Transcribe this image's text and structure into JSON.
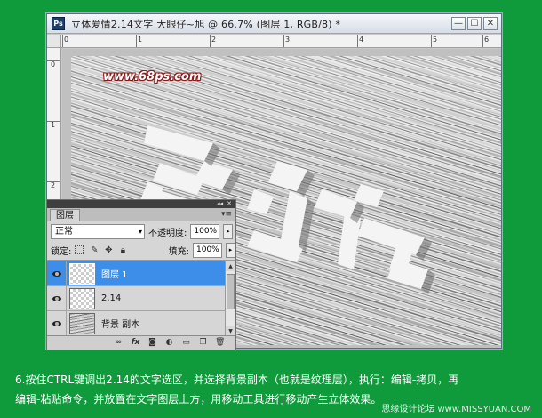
{
  "window": {
    "app_icon": "Ps",
    "title": "立体爱情2.14文字   大眼仔~旭 @ 66.7% (图层 1, RGB/8) *",
    "btn_min": "—",
    "btn_max": "☐",
    "btn_close": "✕"
  },
  "rulers": {
    "top": [
      "0",
      "1",
      "2",
      "3",
      "4",
      "5",
      "6"
    ],
    "left": [
      "0",
      "1",
      "2"
    ]
  },
  "canvas": {
    "watermark": "www.68ps.com"
  },
  "layers_panel": {
    "collapse": "◂◂",
    "close": "✕",
    "tab": "图层",
    "menu_icon": "▾≡",
    "blend_mode": "正常",
    "dropdown_arrow": "▾",
    "opacity_label": "不透明度:",
    "opacity_value": "100%",
    "lock_label": "锁定:",
    "fill_label": "填充:",
    "fill_value": "100%",
    "stepper": "▸",
    "layers": [
      {
        "name": "图层 1",
        "selected": true
      },
      {
        "name": "2.14",
        "selected": false
      },
      {
        "name": "背景 副本",
        "selected": false
      }
    ],
    "footer_icons": [
      "link-icon",
      "fx-icon",
      "mask-icon",
      "adjustment-icon",
      "group-icon",
      "new-layer-icon",
      "trash-icon"
    ]
  },
  "caption": {
    "line1": "6.按住CTRL键调出2.14的文字选区，并选择背景副本（也就是纹理层），执行：编辑-拷贝，再",
    "line2": "编辑-粘贴命令，并放置在文字图层上方，用移动工具进行移动产生立体效果。"
  },
  "credit": "思缘设计论坛 www.MISSYUAN.COM"
}
